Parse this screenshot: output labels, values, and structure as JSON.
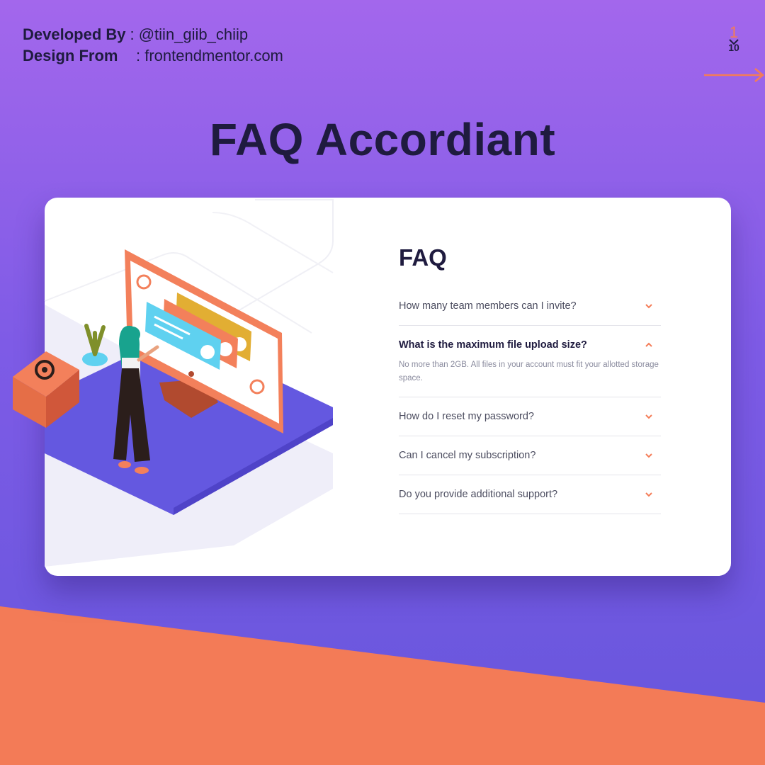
{
  "credits": {
    "developed_label": "Developed By",
    "developed_value": ": @tiin_giib_chiip",
    "design_label": "Design From",
    "design_value": ": frontendmentor.com"
  },
  "pager": {
    "current": "1",
    "total": "10"
  },
  "headline": "FAQ Accordiant",
  "faq": {
    "title": "FAQ",
    "items": [
      {
        "question": "How many team members can I invite?",
        "open": false
      },
      {
        "question": "What is the maximum file upload size?",
        "open": true,
        "answer": "No more than 2GB. All files in your account must fit your allotted storage space."
      },
      {
        "question": "How do I reset my password?",
        "open": false
      },
      {
        "question": "Can I cancel my subscription?",
        "open": false
      },
      {
        "question": "Do you provide additional support?",
        "open": false
      }
    ]
  },
  "colors": {
    "accent": "#F47C57",
    "purple": "#6458E0",
    "dark_text": "#1F1B3F"
  }
}
